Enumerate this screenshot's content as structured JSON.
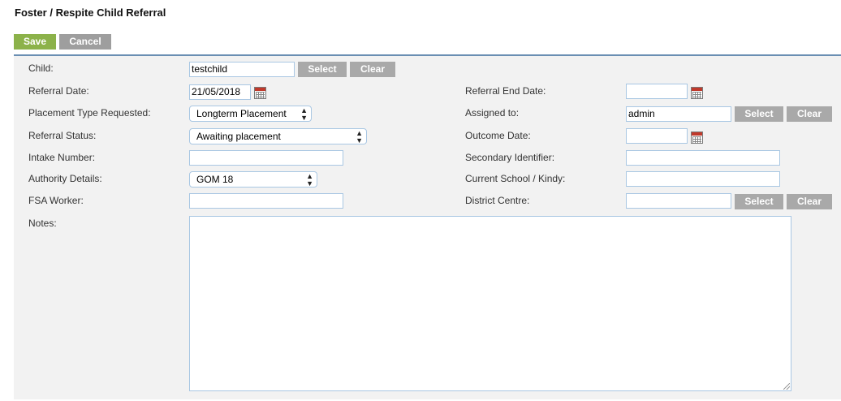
{
  "page": {
    "title": "Foster / Respite Child Referral"
  },
  "toolbar": {
    "save_label": "Save",
    "cancel_label": "Cancel"
  },
  "form": {
    "child": {
      "label": "Child:",
      "value": "testchild",
      "select_label": "Select",
      "clear_label": "Clear"
    },
    "referral_date": {
      "label": "Referral Date:",
      "value": "21/05/2018",
      "icon": "calendar-icon"
    },
    "placement_type": {
      "label": "Placement Type Requested:",
      "value": "Longterm Placement"
    },
    "referral_status": {
      "label": "Referral Status:",
      "value": "Awaiting placement"
    },
    "intake_number": {
      "label": "Intake Number:",
      "value": ""
    },
    "authority_details": {
      "label": "Authority Details:",
      "value": "GOM 18"
    },
    "fsa_worker": {
      "label": "FSA Worker:",
      "value": ""
    },
    "notes": {
      "label": "Notes:",
      "value": ""
    },
    "referral_end_date": {
      "label": "Referral End Date:",
      "value": "",
      "icon": "calendar-icon"
    },
    "assigned_to": {
      "label": "Assigned to:",
      "value": "admin",
      "select_label": "Select",
      "clear_label": "Clear"
    },
    "outcome_date": {
      "label": "Outcome Date:",
      "value": "",
      "icon": "calendar-icon"
    },
    "secondary_identifier": {
      "label": "Secondary Identifier:",
      "value": ""
    },
    "current_school": {
      "label": "Current School / Kindy:",
      "value": ""
    },
    "district_centre": {
      "label": "District Centre:",
      "value": "",
      "select_label": "Select",
      "clear_label": "Clear"
    }
  },
  "colors": {
    "save_button": "#8cb24a",
    "secondary_button": "#a9a9a9",
    "divider": "#6a8fb3",
    "panel_background": "#f2f2f2",
    "input_border": "#a9c7e3"
  }
}
